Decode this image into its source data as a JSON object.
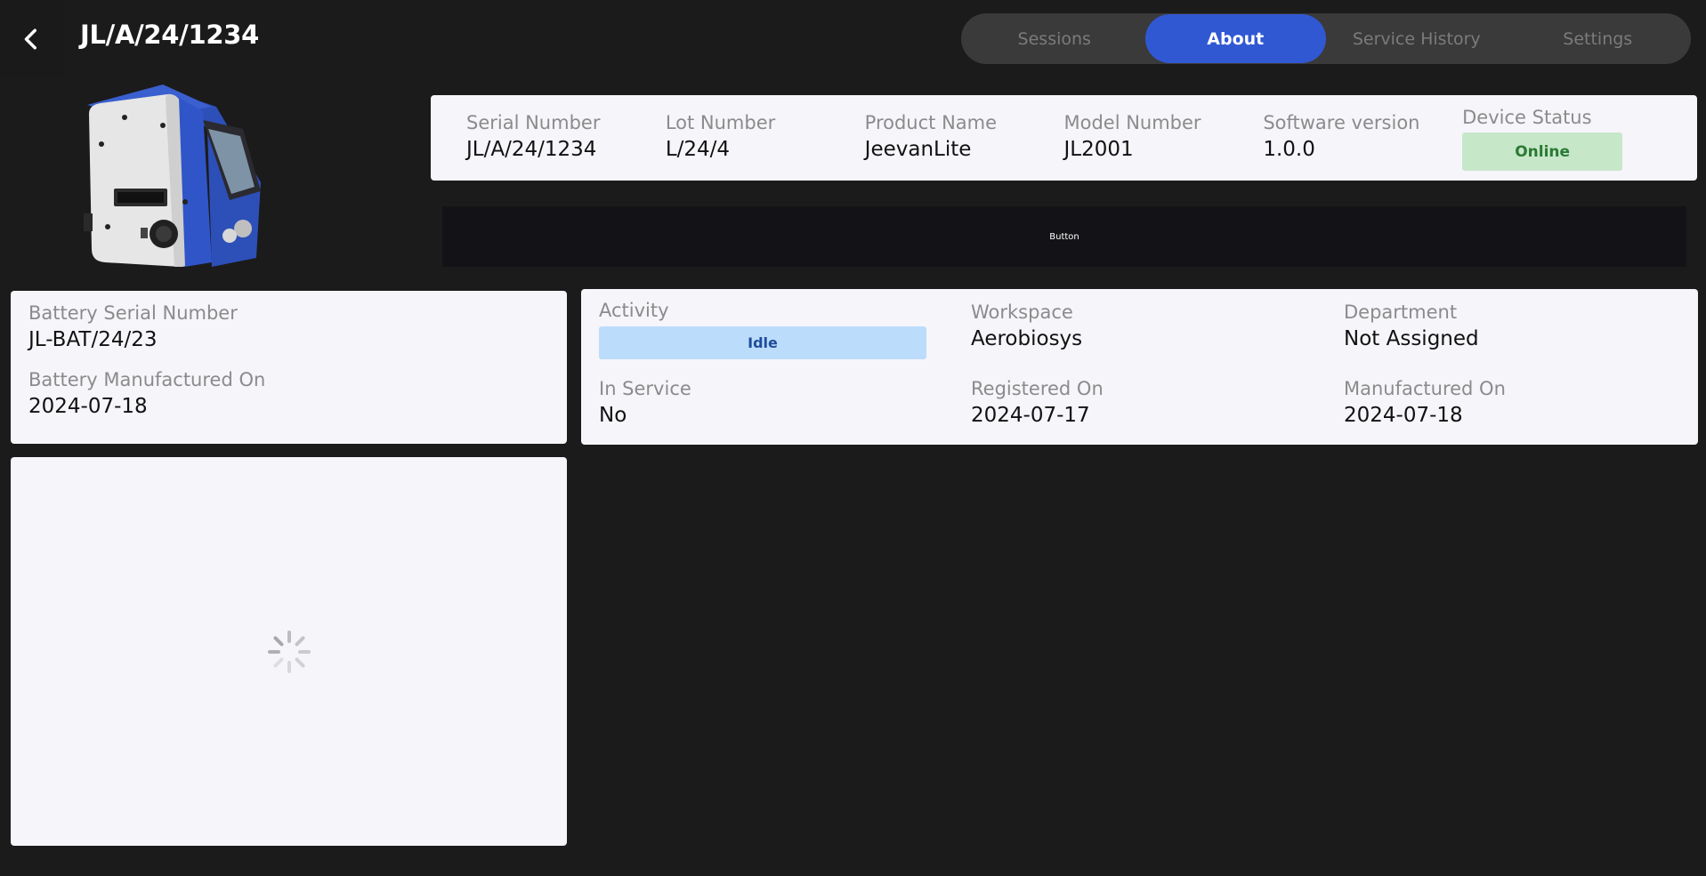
{
  "header": {
    "title": "JL/A/24/1234"
  },
  "tabs": [
    {
      "label": "Sessions",
      "active": false
    },
    {
      "label": "About",
      "active": true
    },
    {
      "label": "Service History",
      "active": false
    },
    {
      "label": "Settings",
      "active": false
    }
  ],
  "device_info": {
    "serial_number": {
      "label": "Serial Number",
      "value": "JL/A/24/1234"
    },
    "lot_number": {
      "label": "Lot Number",
      "value": "L/24/4"
    },
    "product_name": {
      "label": "Product Name",
      "value": "JeevanLite"
    },
    "model_number": {
      "label": "Model Number",
      "value": "JL2001"
    },
    "software_version": {
      "label": "Software version",
      "value": "1.0.0"
    },
    "device_status": {
      "label": "Device Status",
      "value": "Online"
    }
  },
  "action_button": {
    "label": "Button"
  },
  "battery": {
    "serial": {
      "label": "Battery Serial Number",
      "value": "JL-BAT/24/23"
    },
    "manufactured": {
      "label": "Battery Manufactured On",
      "value": "2024-07-18"
    }
  },
  "activity_panel": {
    "activity": {
      "label": "Activity",
      "value": "Idle"
    },
    "workspace": {
      "label": "Workspace",
      "value": "Aerobiosys"
    },
    "department": {
      "label": "Department",
      "value": "Not Assigned"
    },
    "in_service": {
      "label": "In Service",
      "value": "No"
    },
    "registered_on": {
      "label": "Registered On",
      "value": "2024-07-17"
    },
    "manufactured_on": {
      "label": "Manufactured On",
      "value": "2024-07-18"
    }
  },
  "colors": {
    "accent": "#3158d3",
    "online_bg": "#c7e7c9",
    "online_text": "#2a7a35",
    "idle_bg": "#bcdcfb",
    "idle_text": "#1f4d9a"
  },
  "icons": {
    "back": "chevron-left-icon",
    "loading": "spinner-icon"
  }
}
